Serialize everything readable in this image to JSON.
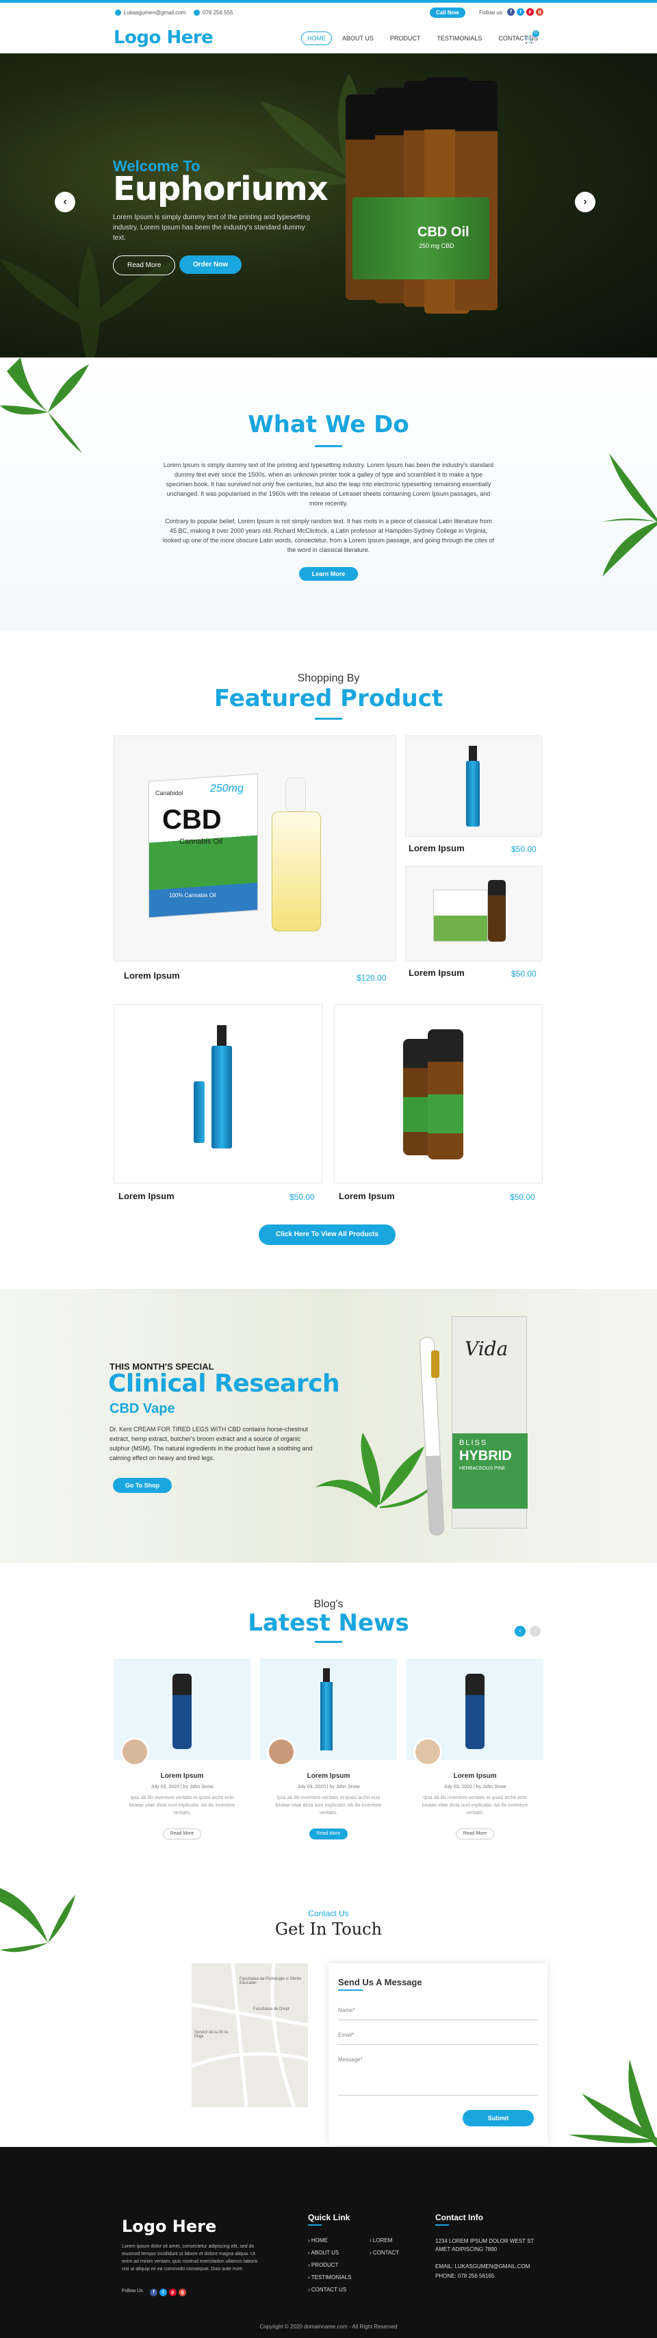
{
  "topbar": {
    "email": "Lukasgumen@gmail.com",
    "phone": "078 256 555",
    "call_now": "Call Now",
    "follow_us": "Follow us:",
    "social": [
      "f",
      "t",
      "p",
      "g"
    ]
  },
  "header": {
    "logo": "Logo Here",
    "nav": [
      "HOME",
      "ABOUT US",
      "PRODUCT",
      "TESTIMONIALS",
      "CONTACT US"
    ],
    "cart_count": "0"
  },
  "hero": {
    "welcome": "Welcome To",
    "brand": "Euphoriumx",
    "description": "Lorem Ipsum is simply dummy text of the printing and typesetting industry. Lorem Ipsum has been the industry's standard dummy text.",
    "read_more": "Read More",
    "order_now": "Order Now",
    "bottle_label": "CBD Oil",
    "bottle_sub": "250 mg CBD"
  },
  "what_we_do": {
    "title": "What We Do",
    "para1": "Lorem Ipsum is simply dummy text of the printing and typesetting industry. Lorem Ipsum has been the industry's standard dummy text ever since the 1500s, when an unknown printer took a galley of type and scrambled it to make a type specimen book. It has survived not only five centuries, but also the leap into electronic typesetting remaining essentially unchanged. It was popularised in the 1960s with the release of Letraset sheets containing Lorem Ipsum passages, and more recently.",
    "para2": "Contrary to popular belief, Lorem Ipsum is not simply random text. It has roots in a piece of classical Latin literature from 45 BC, making it over 2000 years old. Richard McClintock, a Latin professor at Hampden-Sydney College in Virginia, looked up one of the more obscure Latin words, consectetur, from a Lorem Ipsum passage, and going through the cites of the word in classical literature.",
    "button": "Learn More"
  },
  "featured": {
    "subtitle": "Shopping By",
    "title": "Featured Product",
    "products": [
      {
        "name": "Lorem Ipsum",
        "price": "$120.00"
      },
      {
        "name": "Lorem Ipsum",
        "price": "$50.00"
      },
      {
        "name": "Lorem Ipsum",
        "price": "$50.00"
      },
      {
        "name": "Lorem Ipsum",
        "price": "$50.00"
      },
      {
        "name": "Lorem Ipsum",
        "price": "$50.00"
      }
    ],
    "box_brand": "Canabidol",
    "box_mg": "250mg",
    "box_cbd": "CBD",
    "box_oil": "Cannabis Oil",
    "box_pct": "100% Cannabis Oil",
    "button": "Click Here To View All Products"
  },
  "clinical": {
    "kicker": "THIS MONTH'S SPECIAL",
    "title": "Clinical Research",
    "subtitle": "CBD Vape",
    "text": "Dr. Kent CREAM FOR TIRED LEGS WITH CBD contains horse-chestnut extract, hemp extract, butcher's broom extract and a source of organic sulphur (MSM). The natural ingredients in the product have a soothing and calming effect on heavy and tired legs.",
    "button": "Go To Shop",
    "pack_brand": "Vida",
    "pack_line1": "BLISS",
    "pack_line2": "HYBRID",
    "pack_line3": "HERBACEOUS PINE"
  },
  "news": {
    "subtitle": "Blog's",
    "title": "Latest News",
    "items": [
      {
        "title": "Lorem Ipsum",
        "meta": "July 03, 2020  |  by John Snow",
        "text": "Ipsa ab illo inventore veritatis et quasi archit ecto beatae vitae dicta sunt explicabo. Ab illo inventore veritatis.",
        "button": "Read More"
      },
      {
        "title": "Lorem Ipsum",
        "meta": "July 03, 2020  |  by John Snow",
        "text": "Ipsa ab illo inventore veritatis et quasi archit ecto beatae vitae dicta sunt explicabo. Ab illo inventore veritatis.",
        "button": "Read More"
      },
      {
        "title": "Lorem Ipsum",
        "meta": "July 03, 2020  |  by John Snow",
        "text": "Ipsa ab illo inventore veritatis et quasi archit ecto beatae vitae dicta sunt explicabo. Ab illo inventore veritatis.",
        "button": "Read More"
      }
    ]
  },
  "contact": {
    "subtitle": "Contact Us",
    "title": "Get In Touch",
    "form_title": "Send Us A Message",
    "name_label": "Name*",
    "email_label": "Email*",
    "message_label": "Message*",
    "submit": "Submit",
    "map_labels": [
      "Facultatea de Psihologie si Stiinte Educatiei",
      "Facultatea de Drept",
      "Servicii de la 30 la Plaja"
    ]
  },
  "footer": {
    "logo": "Logo Here",
    "desc": "Lorem ipsum dolor sit amet, consectetur adipiscing elit, sed do eiusmod tempor incididunt ut labore et dolore magna aliqua. Ut enim ad minim veniam, quis nostrud exercitation ullamco laboris nisi ut aliquip ex ea commodo consequat. Duis aute irure.",
    "follow_us": "Follow Us",
    "quick_link": "Quick Link",
    "links_col1": [
      "HOME",
      "ABOUT US",
      "PRODUCT",
      "TESTIMONIALS",
      "CONTACT US"
    ],
    "links_col2": [
      "LOREM",
      "CONTACT"
    ],
    "contact_info": "Contact Info",
    "address": "1234 LOREM IPSUM DOLOR WEST ST AMET ADIPISCING 7890",
    "email": "EMAIL: LUKASGUMEN@GMAIL.COM",
    "phone": "PHONE: 078 256 56165",
    "copyright": "Copyright © 2020 domainname.com - All Right Reserved"
  },
  "colors": {
    "accent": "#1aa6de",
    "footer_bg": "#111111"
  }
}
